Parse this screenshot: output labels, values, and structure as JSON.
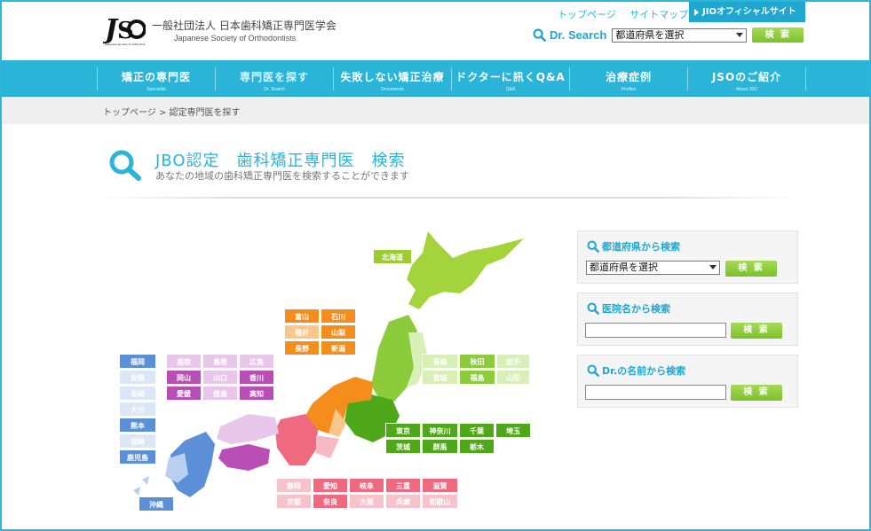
{
  "header": {
    "org_name_jp": "一般社団法人 日本歯科矯正専門医学会",
    "org_name_en": "Japanese Society of Orthodontists",
    "logo_text": "JSO",
    "logo_sub": "Japanese Society of Orthodontists",
    "top_links": [
      "トップページ",
      "サイトマップ"
    ],
    "official_site_label": "JIOオフィシャルサイト",
    "dr_search_label": "Dr. Search",
    "pref_select_value": "都道府県を選択",
    "search_button": "検 索"
  },
  "nav": [
    {
      "jp": "矯正の専門医",
      "en": "Specialist"
    },
    {
      "jp": "専門医を探す",
      "en": "Dr. Search"
    },
    {
      "jp": "失敗しない矯正治療",
      "en": "Documents"
    },
    {
      "jp": "ドクターに訊くQ&A",
      "en": "Q&A"
    },
    {
      "jp": "治療症例",
      "en": "Profiles"
    },
    {
      "jp": "JSOのご紹介",
      "en": "About JSO"
    }
  ],
  "breadcrumb": "トップページ > 認定専門医を探す",
  "page": {
    "title": "JBO認定　歯科矯正専門医　検索",
    "subtitle": "あなたの地域の歯科矯正専門医を検索することができます"
  },
  "panels": {
    "pref": {
      "title": "都道府県から検索",
      "select_value": "都道府県を選択",
      "button": "検 索"
    },
    "clinic": {
      "title": "医院名から検索",
      "value": "",
      "button": "検 索"
    },
    "doctor": {
      "title": "Dr.の名前から検索",
      "value": "",
      "button": "検 索"
    }
  },
  "colors": {
    "accent": "#29b4d8",
    "hokkaido": "#9ccc2f",
    "tohoku": "#8ccc3b",
    "kanto": "#4ea81a",
    "chubu": "#f58d1c",
    "kinki": "#ef6a7f",
    "chugoku_shikoku": "#b94fb6",
    "kyushu": "#5b8fd8"
  },
  "prefectures": {
    "hokkaido": [
      "北海道"
    ],
    "tohoku": [
      "青森",
      "秋田",
      "岩手",
      "宮城",
      "福島",
      "山形"
    ],
    "chubu_north": [
      "富山",
      "石川",
      "福井",
      "山梨",
      "長野",
      "新潟"
    ],
    "chugoku_shikoku": [
      "鳥取",
      "島根",
      "広島",
      "岡山",
      "山口",
      "香川",
      "愛媛",
      "徳島",
      "高知"
    ],
    "kyushu": [
      "福岡",
      "佐賀",
      "長崎",
      "大分",
      "熊本",
      "宮崎",
      "鹿児島",
      "沖縄"
    ],
    "kanto": [
      "東京",
      "神奈川",
      "千葉",
      "埼玉",
      "茨城",
      "群馬",
      "栃木"
    ],
    "kinki": [
      "静岡",
      "愛知",
      "岐阜",
      "三重",
      "滋賀",
      "京都",
      "奈良",
      "大阪",
      "兵庫",
      "和歌山"
    ]
  }
}
